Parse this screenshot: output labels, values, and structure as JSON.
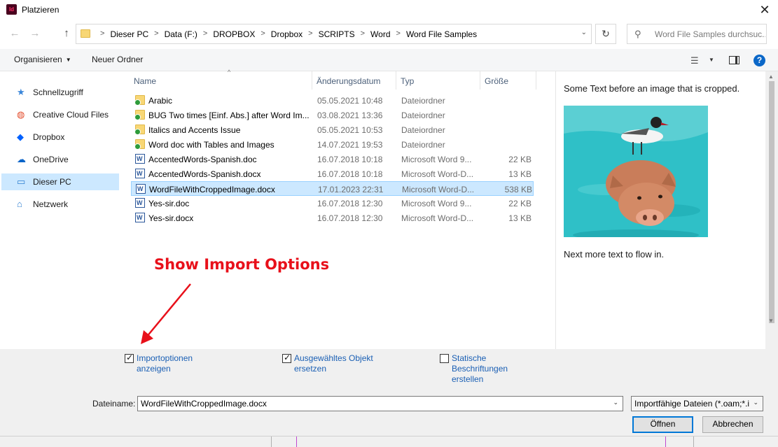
{
  "window": {
    "title": "Platzieren",
    "app_icon_text": "Id",
    "close_glyph": "✕"
  },
  "nav": {
    "back_glyph": "←",
    "forward_glyph": "→",
    "up_glyph": "↑",
    "breadcrumbs": [
      "Dieser PC",
      "Data (F:)",
      "DROPBOX",
      "Dropbox",
      "SCRIPTS",
      "Word",
      "Word File Samples"
    ],
    "breadcrumb_sep": ">",
    "search_placeholder": "Word File Samples durchsuc..."
  },
  "toolbar": {
    "organize_label": "Organisieren",
    "new_folder_label": "Neuer Ordner"
  },
  "sidebar": {
    "items": [
      {
        "label": "Schnellzugriff",
        "icon": "star-icon",
        "glyph": "★",
        "color": "#3a86d9",
        "selected": false
      },
      {
        "label": "Creative Cloud Files",
        "icon": "creative-cloud-icon",
        "glyph": "◍",
        "color": "#e34b2a",
        "selected": false
      },
      {
        "label": "Dropbox",
        "icon": "dropbox-icon",
        "glyph": "◆",
        "color": "#0061fe",
        "selected": false
      },
      {
        "label": "OneDrive",
        "icon": "onedrive-icon",
        "glyph": "☁",
        "color": "#0a64c8",
        "selected": false
      },
      {
        "label": "Dieser PC",
        "icon": "computer-icon",
        "glyph": "▭",
        "color": "#2f7fd1",
        "selected": true
      },
      {
        "label": "Netzwerk",
        "icon": "network-icon",
        "glyph": "⌂",
        "color": "#2f7fd1",
        "selected": false
      }
    ]
  },
  "columns": {
    "name": "Name",
    "date": "Änderungsdatum",
    "type": "Typ",
    "size": "Größe"
  },
  "files": [
    {
      "name": "Arabic",
      "date": "05.05.2021 10:48",
      "type": "Dateiordner",
      "size": "",
      "kind": "folder",
      "selected": false
    },
    {
      "name": "BUG Two times [Einf. Abs.] after Word Im...",
      "date": "03.08.2021 13:36",
      "type": "Dateiordner",
      "size": "",
      "kind": "folder",
      "selected": false
    },
    {
      "name": "Italics and Accents Issue",
      "date": "05.05.2021 10:53",
      "type": "Dateiordner",
      "size": "",
      "kind": "folder",
      "selected": false
    },
    {
      "name": "Word doc with Tables and Images",
      "date": "14.07.2021 19:53",
      "type": "Dateiordner",
      "size": "",
      "kind": "folder",
      "selected": false
    },
    {
      "name": "AccentedWords-Spanish.doc",
      "date": "16.07.2018 10:18",
      "type": "Microsoft Word 9...",
      "size": "22 KB",
      "kind": "word",
      "selected": false
    },
    {
      "name": "AccentedWords-Spanish.docx",
      "date": "16.07.2018 10:18",
      "type": "Microsoft Word-D...",
      "size": "13 KB",
      "kind": "word",
      "selected": false
    },
    {
      "name": "WordFileWithCroppedImage.docx",
      "date": "17.01.2023 22:31",
      "type": "Microsoft Word-D...",
      "size": "538 KB",
      "kind": "word",
      "selected": true
    },
    {
      "name": "Yes-sir.doc",
      "date": "16.07.2018 12:30",
      "type": "Microsoft Word 9...",
      "size": "22 KB",
      "kind": "word",
      "selected": false
    },
    {
      "name": "Yes-sir.docx",
      "date": "16.07.2018 12:30",
      "type": "Microsoft Word-D...",
      "size": "13 KB",
      "kind": "word",
      "selected": false
    }
  ],
  "preview": {
    "text_before": "Some Text before an image that is cropped.",
    "text_after": "Next more text to flow in.",
    "image_subject": "pig-swimming-with-seagull"
  },
  "options": {
    "import_options": {
      "line1": "Importoptionen",
      "line2": "anzeigen",
      "checked": true
    },
    "replace_selected": {
      "line1": "Ausgewähltes Objekt",
      "line2": "ersetzen",
      "checked": true
    },
    "static_captions": {
      "line1": "Statische",
      "line2": "Beschriftungen",
      "line3": "erstellen",
      "checked": false
    }
  },
  "footer": {
    "filename_label": "Dateiname:",
    "filename_value": "WordFileWithCroppedImage.docx",
    "filetype_value": "Importfähige Dateien (*.oam;*.i",
    "open_label": "Öffnen",
    "cancel_label": "Abbrechen"
  },
  "annotation": {
    "text": "Show Import Options",
    "color": "#e8101a"
  }
}
